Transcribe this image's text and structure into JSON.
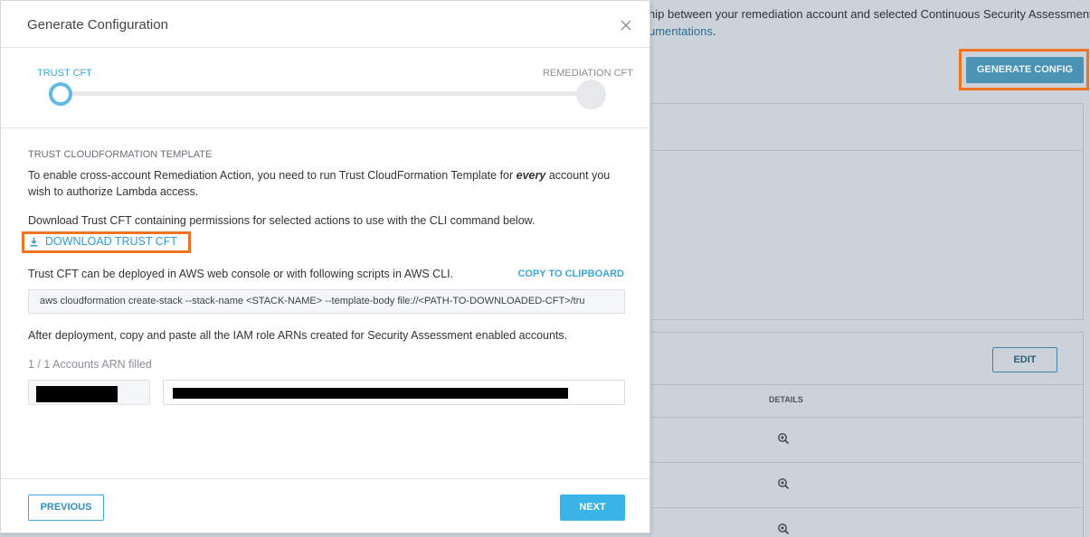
{
  "background": {
    "intro_line1": "hip between your remediation account and selected Continuous Security Assessment",
    "intro_link": "umentations",
    "intro_tail": ".",
    "generate_config_label": "GENERATE CONFIG",
    "edit_label": "EDIT",
    "details_header": "DETAILS",
    "zoom_icon": "zoom-in-icon"
  },
  "modal": {
    "title": "Generate Configuration",
    "close_icon": "close-icon",
    "steps": [
      {
        "label": "TRUST CFT",
        "state": "active"
      },
      {
        "label": "REMEDIATION CFT",
        "state": "inactive"
      }
    ],
    "section_title": "TRUST CLOUDFORMATION TEMPLATE",
    "intro_text_before": "To enable cross-account Remediation Action, you need to run Trust CloudFormation Template for ",
    "intro_text_emphasis": "every",
    "intro_text_after": " account you wish to authorize Lambda access.",
    "download_text": "Download Trust CFT containing permissions for selected actions to use with the CLI command below.",
    "download_link": "DOWNLOAD TRUST CFT",
    "download_icon": "download-icon",
    "deploy_text": "Trust CFT can be deployed in AWS web console or with following scripts in AWS CLI.",
    "copy_label": "COPY TO CLIPBOARD",
    "cli_command": "aws cloudformation create-stack --stack-name <STACK-NAME> --template-body file://<PATH-TO-DOWNLOADED-CFT>/tru",
    "after_text": "After deployment, copy and paste all the IAM role ARNs created for Security Assessment enabled accounts.",
    "arn_count": "1 / 1 Accounts ARN filled",
    "previous_label": "PREVIOUS",
    "next_label": "NEXT"
  },
  "colors": {
    "accent": "#3ba7d8",
    "highlight": "#f0731f",
    "next_button": "#3ab3e6"
  }
}
